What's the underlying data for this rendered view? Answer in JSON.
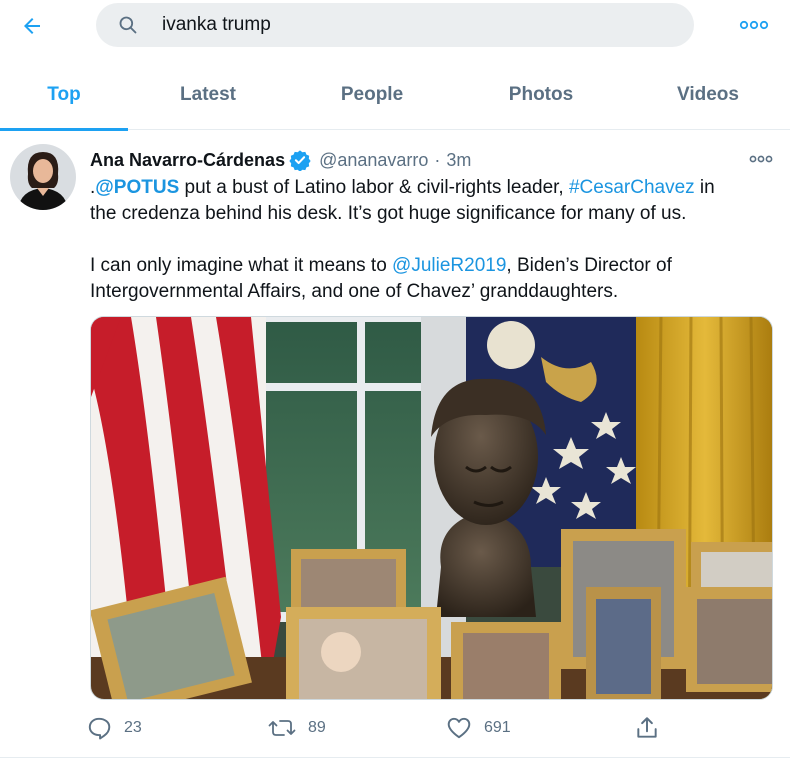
{
  "search": {
    "query": "ivanka trump"
  },
  "tabs": [
    {
      "label": "Top"
    },
    {
      "label": "Latest"
    },
    {
      "label": "People"
    },
    {
      "label": "Photos"
    },
    {
      "label": "Videos"
    }
  ],
  "active_tab": "Top",
  "tweet": {
    "display_name": "Ana Navarro-Cárdenas",
    "handle": "@ananavarro",
    "separator": "·",
    "time": "3m",
    "text": {
      "line1_prefix": ".",
      "line1_mention": "@POTUS",
      "line1_mid": " put a bust of Latino labor & civil-rights leader, ",
      "line1_hashtag": "#CesarChavez",
      "line1_suffix": " in",
      "line2": "the credenza behind his desk. It’s got huge significance for many of us.",
      "line3_prefix": "I can only imagine what it means to ",
      "line3_mention": "@JulieR2019",
      "line3_suffix": ", Biden’s Director of",
      "line4": "Intergovernmental Affairs, and one of Chavez’ granddaughters."
    },
    "stats": {
      "replies": "23",
      "retweets": "89",
      "likes": "691"
    }
  },
  "colors": {
    "accent": "#1da1f2",
    "link": "#1b95e0",
    "secondary_text": "#5b7083",
    "search_bg": "#ebeef0",
    "divider": "#e6ecf0"
  },
  "icons": {
    "back": "arrow-left-icon",
    "search": "search-icon",
    "more": "more-horizontal-icon",
    "verified": "verified-badge-icon",
    "reply": "reply-icon",
    "retweet": "retweet-icon",
    "like": "heart-icon",
    "share": "share-icon"
  }
}
